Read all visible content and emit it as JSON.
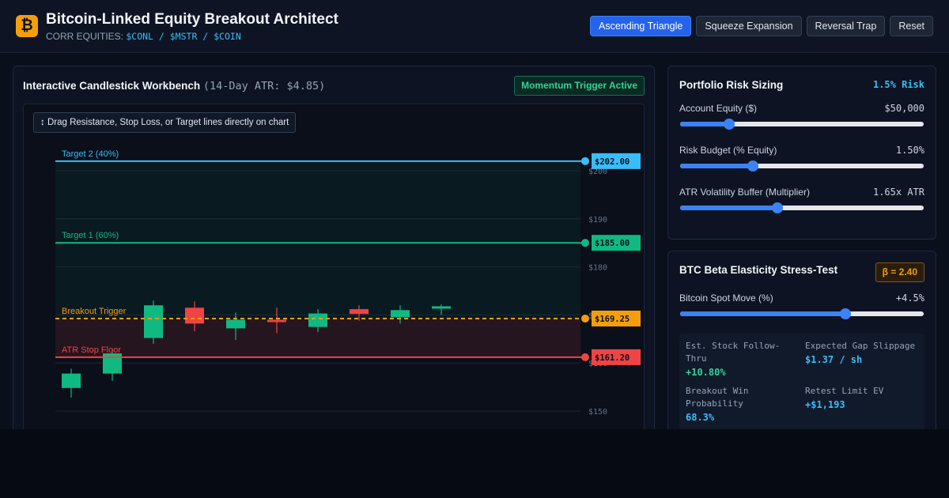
{
  "header": {
    "logo_glyph": "₿",
    "title": "Bitcoin-Linked Equity Breakout Architect",
    "subtitle_prefix": "CORR EQUITIES:",
    "subtitle_tickers": "$CONL / $MSTR / $COIN",
    "buttons": [
      {
        "label": "Ascending Triangle",
        "active": true
      },
      {
        "label": "Squeeze Expansion",
        "active": false
      },
      {
        "label": "Reversal Trap",
        "active": false
      },
      {
        "label": "Reset",
        "active": false
      }
    ]
  },
  "chart_panel": {
    "title": "Interactive Candlestick Workbench",
    "atr_note": "(14-Day ATR: $4.85)",
    "badge": "Momentum Trigger Active",
    "drag_hint": "↕ Drag Resistance, Stop Loss, or Target lines directly on chart"
  },
  "chart_data": {
    "type": "candlestick",
    "y_range": [
      147,
      205
    ],
    "y_ticks": [
      {
        "value": 200,
        "label": "$200"
      },
      {
        "value": 190,
        "label": "$190"
      },
      {
        "value": 180,
        "label": "$180"
      },
      {
        "value": 170,
        "label": "$170"
      },
      {
        "value": 160,
        "label": "$160"
      },
      {
        "value": 150,
        "label": "$150"
      }
    ],
    "levels": [
      {
        "name": "Target 2 (40%)",
        "value": 202.0,
        "price_label": "$202.00",
        "color": "#38bdf8",
        "dashed": false
      },
      {
        "name": "Target 1 (60%)",
        "value": 185.0,
        "price_label": "$185.00",
        "color": "#10b981",
        "dashed": false
      },
      {
        "name": "Breakout Trigger",
        "value": 169.25,
        "price_label": "$169.25",
        "color": "#f59e0b",
        "dashed": true
      },
      {
        "name": "ATR Stop Floor",
        "value": 161.2,
        "price_label": "$161.20",
        "color": "#ef4444",
        "dashed": false
      }
    ],
    "candles": [
      {
        "open": 154.8,
        "close": 157.8,
        "high": 158.8,
        "low": 152.8
      },
      {
        "open": 157.8,
        "close": 162.0,
        "high": 163.0,
        "low": 156.3
      },
      {
        "open": 165.2,
        "close": 172.0,
        "high": 173.0,
        "low": 164.0
      },
      {
        "open": 171.5,
        "close": 168.2,
        "high": 172.8,
        "low": 166.6
      },
      {
        "open": 167.2,
        "close": 169.0,
        "high": 170.5,
        "low": 164.8
      },
      {
        "open": 169.0,
        "close": 168.5,
        "high": 171.5,
        "low": 166.2
      },
      {
        "open": 167.5,
        "close": 170.3,
        "high": 171.2,
        "low": 166.4
      },
      {
        "open": 171.2,
        "close": 170.2,
        "high": 172.0,
        "low": 168.8
      },
      {
        "open": 169.5,
        "close": 171.0,
        "high": 172.0,
        "low": 168.2
      },
      {
        "open": 171.5,
        "close": 171.8,
        "high": 172.2,
        "low": 170.0
      }
    ],
    "colors": {
      "up": "#10b981",
      "down": "#ef4444"
    }
  },
  "risk_panel": {
    "title": "Portfolio Risk Sizing",
    "risk_tag": "1.5% Risk",
    "sliders": [
      {
        "label": "Account Equity ($)",
        "value_text": "$50,000",
        "fraction": 0.2
      },
      {
        "label": "Risk Budget (% Equity)",
        "value_text": "1.50%",
        "fraction": 0.3
      },
      {
        "label": "ATR Volatility Buffer (Multiplier)",
        "value_text": "1.65x ATR",
        "fraction": 0.4
      }
    ]
  },
  "beta_panel": {
    "title": "BTC Beta Elasticity Stress-Test",
    "beta_badge": "β = 2.40",
    "slider": {
      "label": "Bitcoin Spot Move (%)",
      "value_text": "+4.5%",
      "fraction": 0.68
    },
    "stats": [
      {
        "label": "Est. Stock Follow-Thru",
        "value": "+10.80%",
        "tone": "green"
      },
      {
        "label": "Expected Gap Slippage",
        "value": "$1.37 / sh",
        "tone": "blue"
      },
      {
        "label": "Breakout Win Probability",
        "value": "68.3%",
        "tone": "blue"
      },
      {
        "label": "Retest Limit EV",
        "value": "+$1,193",
        "tone": "blue"
      }
    ]
  }
}
